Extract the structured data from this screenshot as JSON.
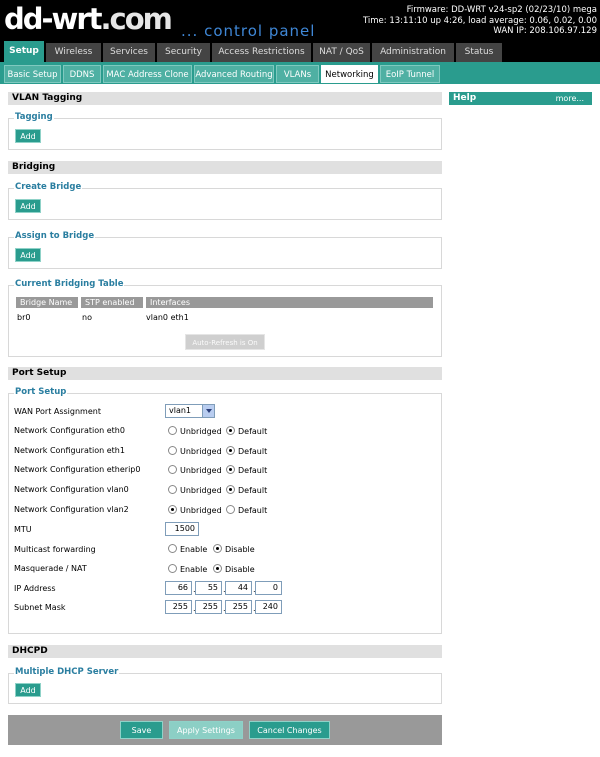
{
  "header": {
    "logo_main": "dd-wrt",
    "logo_suffix": ".com",
    "subtitle": "... control panel",
    "firmware": "Firmware: DD-WRT v24-sp2 (02/23/10) mega",
    "time": "Time: 13:11:10 up 4:26, load average: 0.06, 0.02, 0.00",
    "wan_ip": "WAN IP: 208.106.97.129"
  },
  "main_tabs": [
    "Setup",
    "Wireless",
    "Services",
    "Security",
    "Access Restrictions",
    "NAT / QoS",
    "Administration",
    "Status"
  ],
  "sub_tabs": [
    "Basic Setup",
    "DDNS",
    "MAC Address Clone",
    "Advanced Routing",
    "VLANs",
    "Networking",
    "EoIP Tunnel"
  ],
  "help": {
    "title": "Help",
    "more": "more..."
  },
  "vlan": {
    "section": "VLAN Tagging",
    "legend": "Tagging",
    "add": "Add"
  },
  "bridging": {
    "section": "Bridging",
    "create_legend": "Create Bridge",
    "assign_legend": "Assign to Bridge",
    "table_legend": "Current Bridging Table",
    "add": "Add",
    "columns": [
      "Bridge Name",
      "STP enabled",
      "Interfaces"
    ],
    "row": [
      "br0",
      "no",
      "vlan0 eth1"
    ],
    "autorefresh": "Auto-Refresh is On"
  },
  "port": {
    "section": "Port Setup",
    "legend": "Port Setup",
    "wan_label": "WAN Port Assignment",
    "wan_value": "vlan1",
    "unbridged": "Unbridged",
    "default": "Default",
    "enable": "Enable",
    "disable": "Disable",
    "net_eth0": "Network Configuration eth0",
    "net_eth1": "Network Configuration eth1",
    "net_etherip0": "Network Configuration etherip0",
    "net_vlan0": "Network Configuration vlan0",
    "net_vlan2": "Network Configuration vlan2",
    "mtu_label": "MTU",
    "mtu_value": "1500",
    "multicast_label": "Multicast forwarding",
    "masq_label": "Masquerade / NAT",
    "ip_label": "IP Address",
    "ip": [
      "66",
      "55",
      "44",
      "0"
    ],
    "mask_label": "Subnet Mask",
    "mask": [
      "255",
      "255",
      "255",
      "240"
    ]
  },
  "dhcpd": {
    "section": "DHCPD",
    "legend": "Multiple DHCP Server",
    "add": "Add"
  },
  "footer": {
    "save": "Save",
    "apply": "Apply Settings",
    "cancel": "Cancel Changes"
  }
}
